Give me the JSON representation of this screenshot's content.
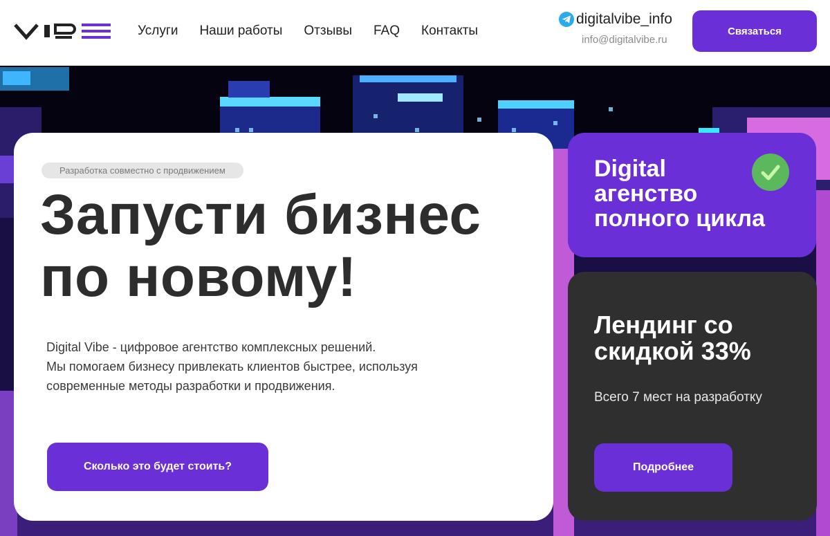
{
  "header": {
    "logo_text": "VIBE",
    "nav": [
      {
        "label": "Услуги"
      },
      {
        "label": "Наши работы"
      },
      {
        "label": "Отзывы"
      },
      {
        "label": "FAQ"
      },
      {
        "label": "Контакты"
      }
    ],
    "telegram_handle": "digitalvibe_info",
    "email": "info@digitalvibe.ru",
    "contact_button": "Связаться"
  },
  "hero": {
    "badge": "Разработка совместно с продвижением",
    "headline_line1": "Запусти бизнес",
    "headline_line2": "по новому!",
    "desc_line1": "Digital Vibe - цифровое агентство комплексных решений.",
    "desc_line2": "Мы помогаем бизнесу привлекать клиентов быстрее, используя",
    "desc_line3": "современные методы разработки и продвижения.",
    "cta_button": "Сколько это будет стоить?"
  },
  "agency_card": {
    "line1": "Digital",
    "line2": "агенство",
    "line3": "полного цикла"
  },
  "promo_card": {
    "line1": "Лендинг со",
    "line2": "скидкой 33%",
    "subtitle": "Всего 7 мест на разработку",
    "button": "Подробнее"
  },
  "colors": {
    "accent": "#6A2FD6",
    "dark_card": "#2f2f2f",
    "check": "#5cb85c",
    "telegram": "#2AABEE"
  }
}
